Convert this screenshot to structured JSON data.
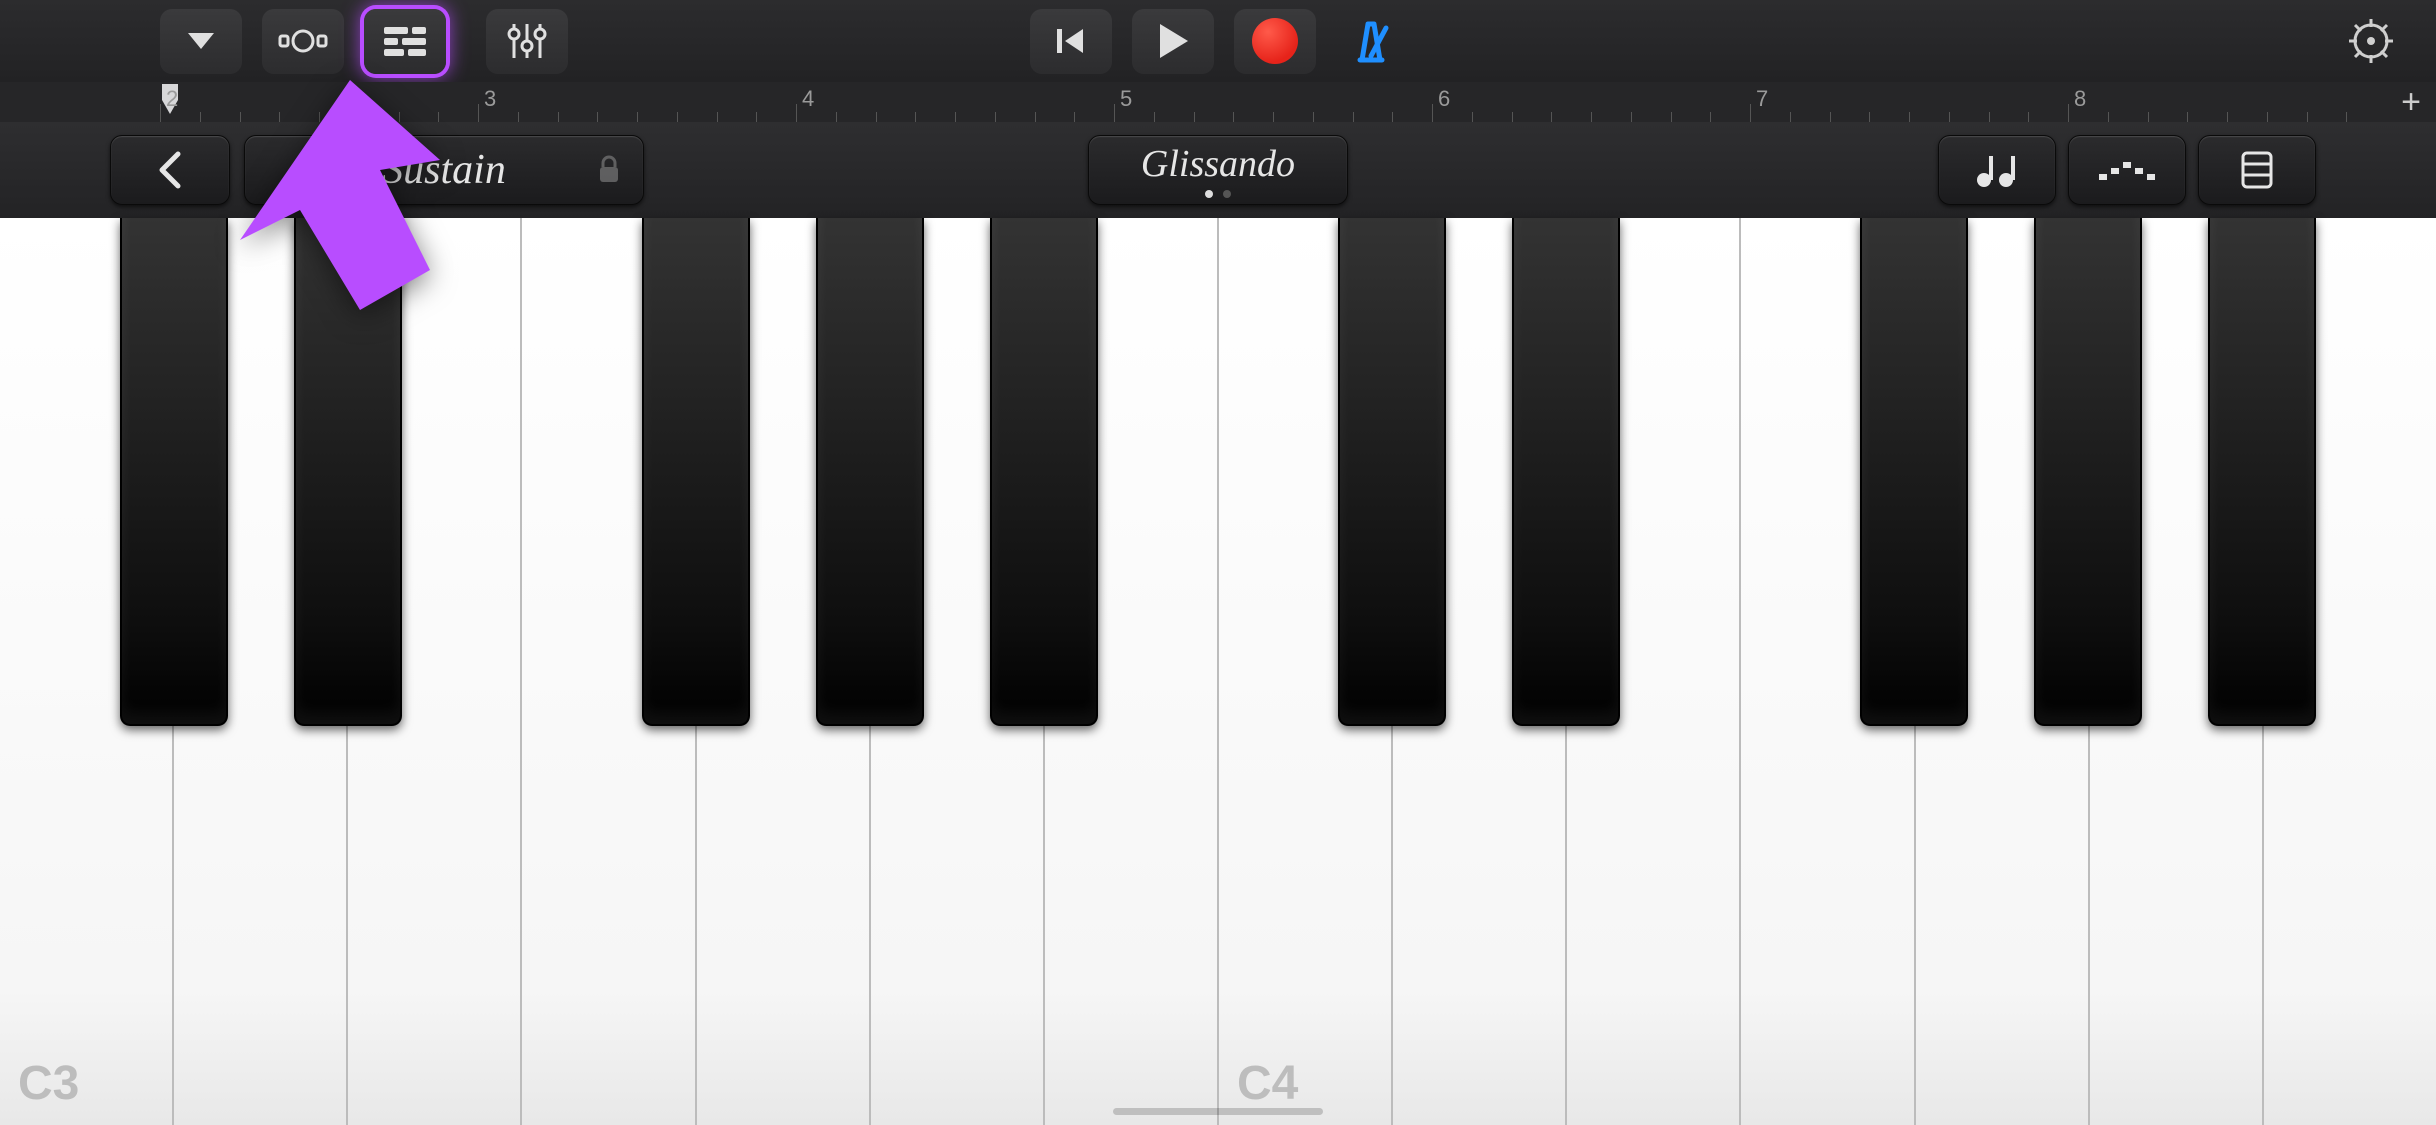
{
  "toolbar": {
    "browser_label": "instrument-browser",
    "fx_label": "fx",
    "tracks_label": "tracks",
    "mixer_label": "mixer",
    "rewind_label": "go-to-beginning",
    "play_label": "play",
    "record_label": "record",
    "metronome_label": "metronome",
    "settings_label": "settings"
  },
  "ruler": {
    "bars": [
      "2",
      "3",
      "4",
      "5",
      "6",
      "7",
      "8"
    ],
    "add_section_label": "+"
  },
  "controls": {
    "back_label": "back",
    "sustain_label": "Sustain",
    "articulation_label": "Glissando",
    "chord_strips_label": "chord-strips",
    "arpeggiator_label": "arpeggiator",
    "keyboard_layout_label": "keyboard-layout"
  },
  "piano": {
    "octave_labels": [
      "C3",
      "C4"
    ],
    "white_key_count": 14,
    "black_key_pattern": [
      0,
      1,
      3,
      4,
      5,
      7,
      8,
      10,
      11,
      12
    ]
  },
  "annotation": {
    "target": "tracks-button",
    "color": "#b84dff"
  }
}
